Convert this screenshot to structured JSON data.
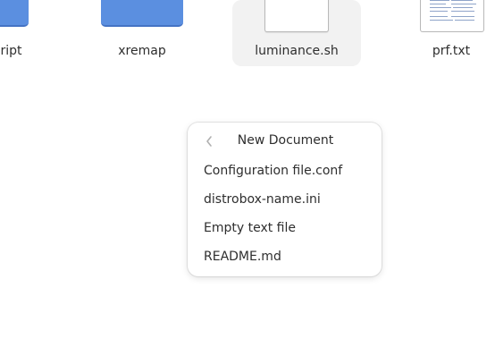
{
  "files": [
    {
      "name": "script",
      "icon": "folder-icon",
      "selected": false
    },
    {
      "name": "xremap",
      "icon": "folder-icon",
      "selected": false
    },
    {
      "name": "luminance.sh",
      "icon": "text-file-icon",
      "selected": true
    },
    {
      "name": "prf.txt",
      "icon": "text-preview-icon",
      "selected": false
    }
  ],
  "popover": {
    "title": "New Document",
    "back_icon": "chevron-left-icon",
    "items": [
      {
        "label": "Configuration file.conf"
      },
      {
        "label": "distrobox-name.ini"
      },
      {
        "label": "Empty text file"
      },
      {
        "label": "README.md"
      }
    ]
  },
  "colors": {
    "folder": "#5b8fe0",
    "folder_edge": "#4473c4",
    "selection": "#f2f2f2",
    "text": "#2e2e2e"
  }
}
